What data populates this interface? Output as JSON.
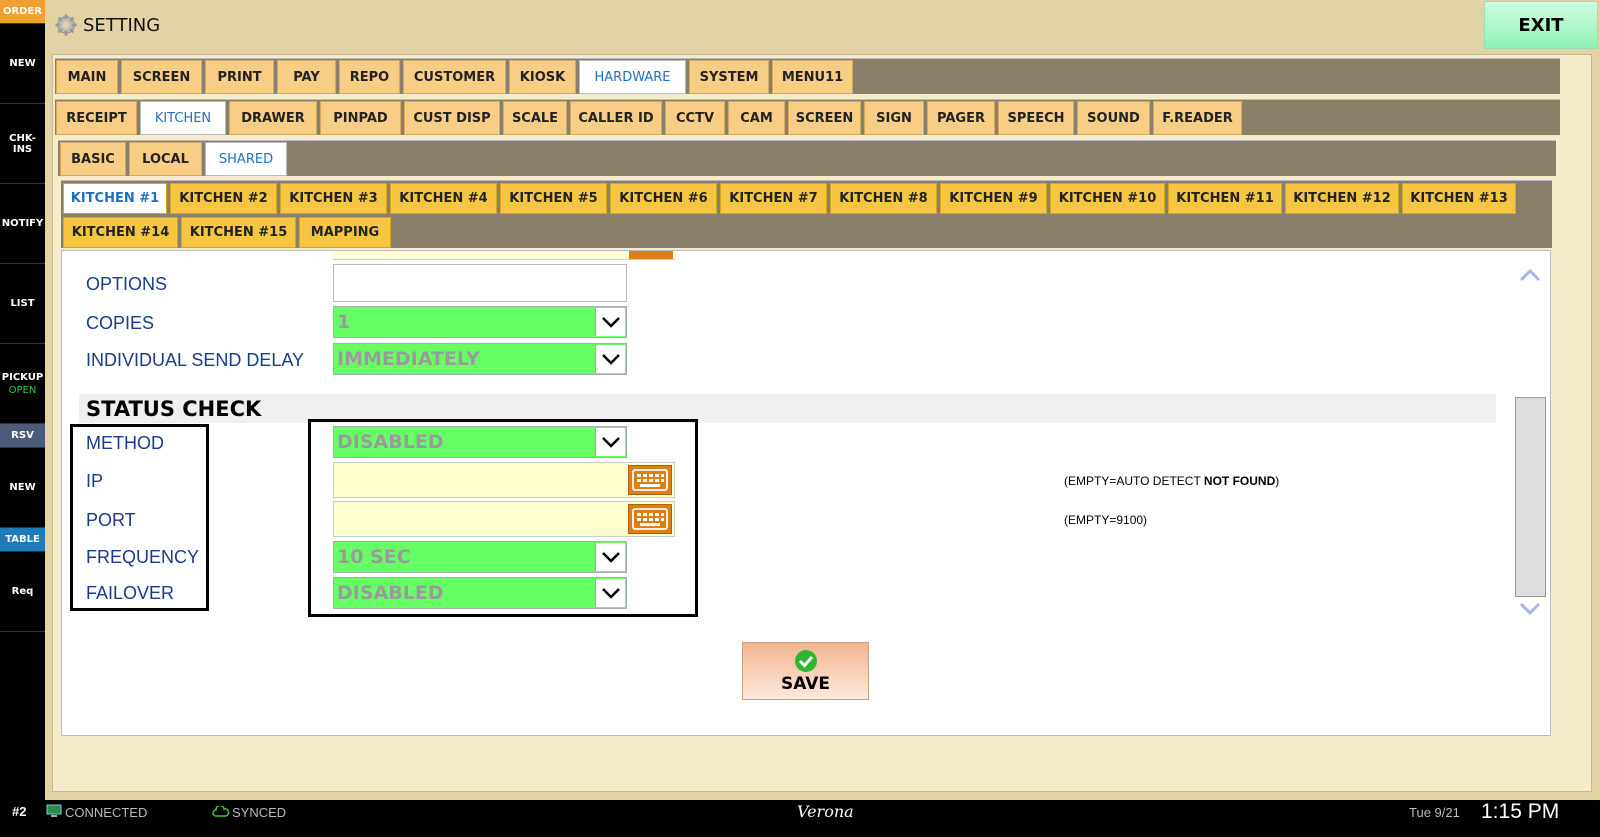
{
  "sidebar": {
    "items": [
      {
        "label": "ORDER"
      },
      {
        "label": "NEW"
      },
      {
        "label": "CHK-INS"
      },
      {
        "label": "NOTIFY"
      },
      {
        "label": "LIST"
      },
      {
        "label": "PICKUP",
        "sub": "OPEN"
      },
      {
        "label": "RSV"
      },
      {
        "label": "NEW"
      },
      {
        "label": "TABLE"
      },
      {
        "label": "Req"
      }
    ]
  },
  "header": {
    "title": "SETTING",
    "exit_label": "EXIT"
  },
  "tabs_level1": [
    "MAIN",
    "SCREEN",
    "PRINT",
    "PAY",
    "REPO",
    "CUSTOMER",
    "KIOSK",
    "HARDWARE",
    "SYSTEM",
    "MENU11"
  ],
  "tabs_level2": [
    "RECEIPT",
    "KITCHEN",
    "DRAWER",
    "PINPAD",
    "CUST DISP",
    "SCALE",
    "CALLER ID",
    "CCTV",
    "CAM",
    "SCREEN",
    "SIGN",
    "PAGER",
    "SPEECH",
    "SOUND",
    "F.READER"
  ],
  "tabs_level3": [
    "BASIC",
    "LOCAL",
    "SHARED"
  ],
  "kitchen_tabs_row1": [
    "KITCHEN #1",
    "KITCHEN #2",
    "KITCHEN #3",
    "KITCHEN #4",
    "KITCHEN #5",
    "KITCHEN #6",
    "KITCHEN #7",
    "KITCHEN #8",
    "KITCHEN #9",
    "KITCHEN #10",
    "KITCHEN #11",
    "KITCHEN #12",
    "KITCHEN #13"
  ],
  "kitchen_tabs_row2": [
    "KITCHEN #14",
    "KITCHEN #15",
    "MAPPING"
  ],
  "form": {
    "options_label": "OPTIONS",
    "copies_label": "COPIES",
    "copies_value": "1",
    "delay_label": "INDIVIDUAL SEND DELAY",
    "delay_value": "IMMEDIATELY",
    "section_title": "STATUS CHECK",
    "method_label": "METHOD",
    "method_value": "DISABLED",
    "ip_label": "IP",
    "ip_value": "",
    "ip_hint_prefix": "(EMPTY=AUTO DETECT ",
    "ip_hint_bold": "NOT FOUND",
    "ip_hint_suffix": ")",
    "port_label": "PORT",
    "port_value": "",
    "port_hint": "(EMPTY=9100)",
    "frequency_label": "FREQUENCY",
    "frequency_value": "10 SEC",
    "failover_label": "FAILOVER",
    "failover_value": "DISABLED",
    "save_label": "SAVE"
  },
  "status_bar": {
    "station": "#2",
    "connected": "CONNECTED",
    "synced": "SYNCED",
    "center": "Verona",
    "date": "Tue 9/21",
    "time": "1:15 PM"
  },
  "colors": {
    "dropdown_green": "#66ff66",
    "tab_orange": "#f8cd86",
    "tab_yellow": "#f6c642",
    "active_tab_text": "#1f6fc0",
    "label_blue": "#1a3a8c"
  }
}
